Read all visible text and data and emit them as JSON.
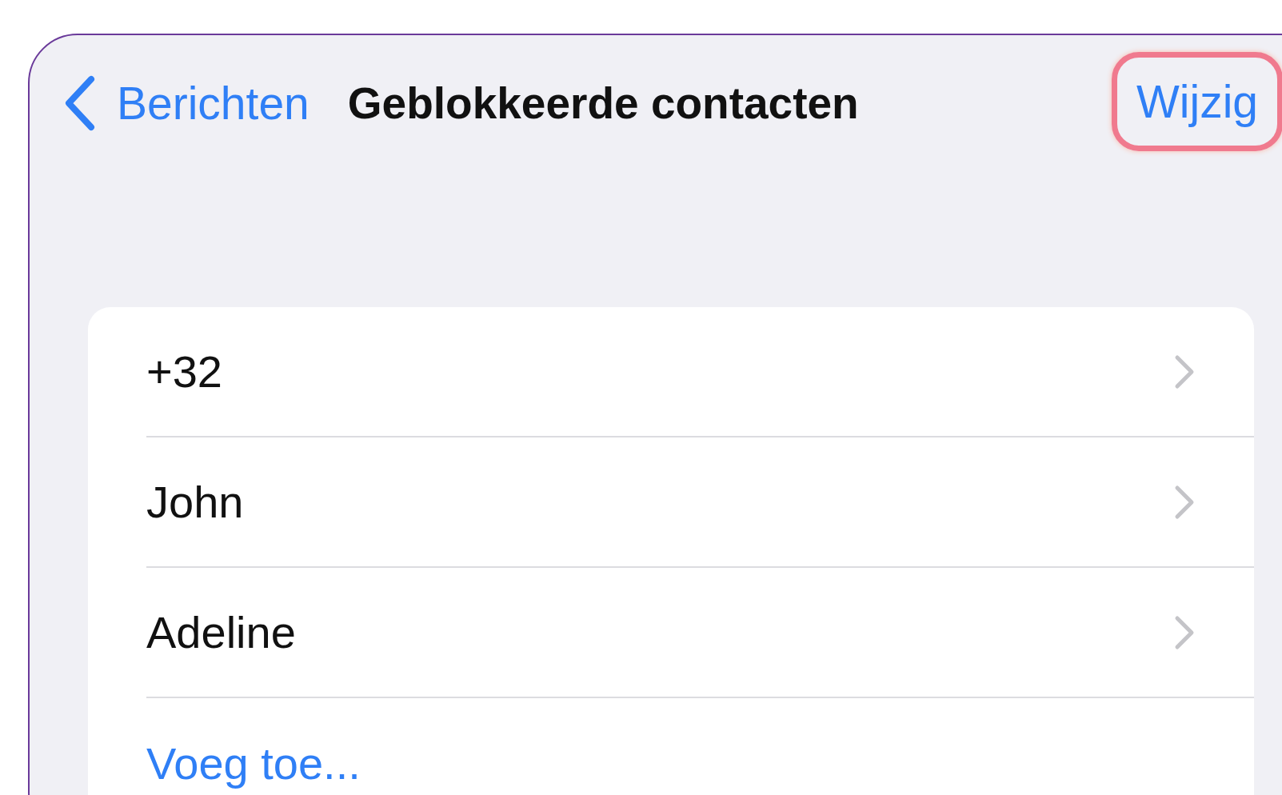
{
  "nav": {
    "back_label": "Berichten",
    "title": "Geblokkeerde contacten",
    "edit_button": {
      "label": "Wijzig",
      "highlighted": true
    }
  },
  "contacts": [
    {
      "name": "+32"
    },
    {
      "name": "John"
    },
    {
      "name": "Adeline"
    }
  ],
  "add_action": "Voeg toe..."
}
